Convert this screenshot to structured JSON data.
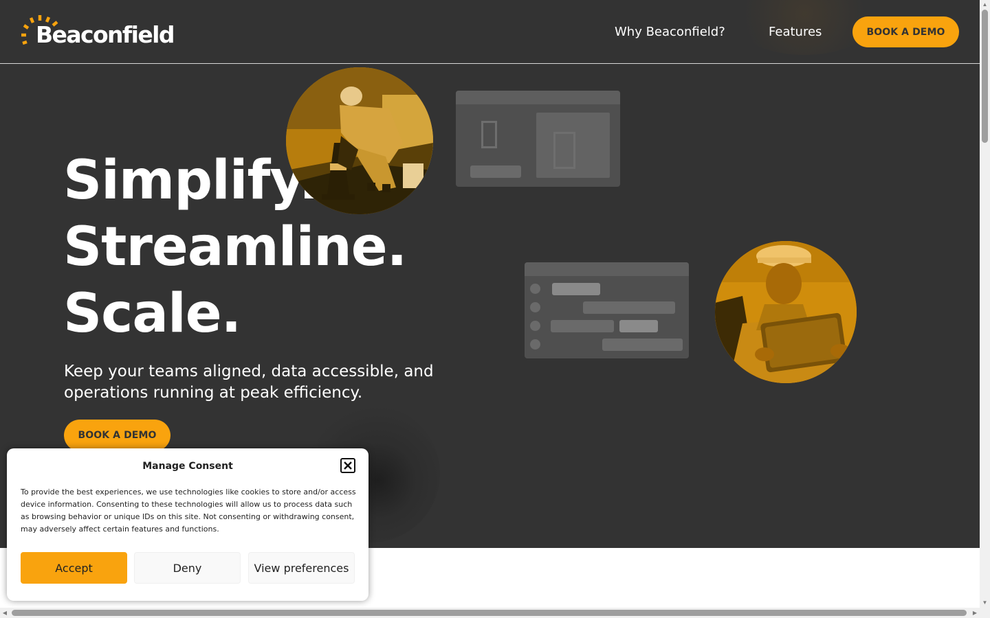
{
  "header": {
    "logo_text": "Beaconfield",
    "nav": [
      {
        "label": "Why Beaconfield?"
      },
      {
        "label": "Features"
      }
    ],
    "cta_label": "BOOK A DEMO"
  },
  "hero": {
    "headline": [
      "Simplify.",
      "Streamline.",
      "Scale."
    ],
    "subtext": "Keep your teams aligned, data accessible, and operations running at peak efficiency.",
    "cta_label": "BOOK A DEMO",
    "images": [
      {
        "icon": "worker-with-traffic-cone-photo"
      },
      {
        "icon": "worker-with-tablet-photo"
      }
    ]
  },
  "consent": {
    "title": "Manage Consent",
    "body": "To provide the best experiences, we use technologies like cookies to store and/or access device information. Consenting to these technologies will allow us to process data such as browsing behavior or unique IDs on this site. Not consenting or withdrawing consent, may adversely affect certain features and functions.",
    "accept_label": "Accept",
    "deny_label": "Deny",
    "preferences_label": "View preferences",
    "close_icon": "close-icon"
  },
  "colors": {
    "brand_accent": "#f9a30e",
    "hero_background": "#333333",
    "text_light": "#ffffff",
    "text_dark": "#222222"
  }
}
